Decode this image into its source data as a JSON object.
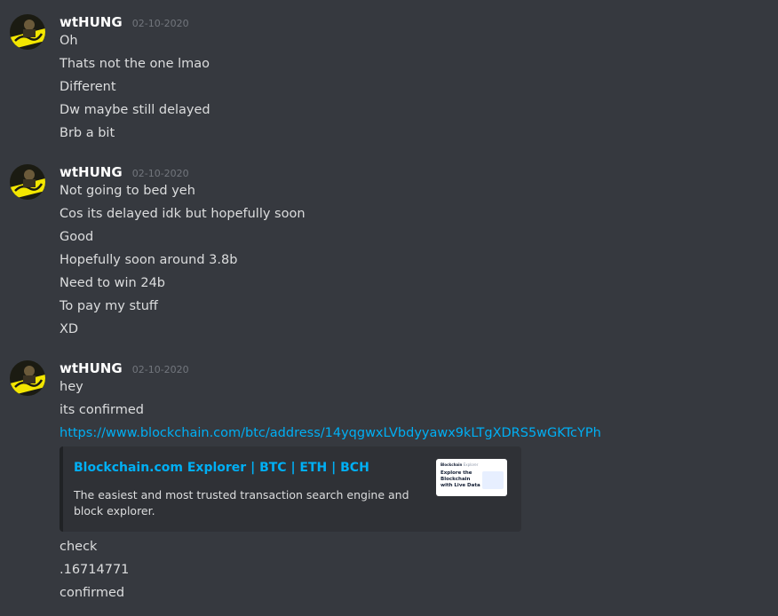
{
  "groups": [
    {
      "username": "wtHUNG",
      "timestamp": "02-10-2020",
      "messages": [
        "Oh",
        "Thats not the one lmao",
        "Different",
        "Dw maybe still delayed",
        "Brb a bit"
      ]
    },
    {
      "username": "wtHUNG",
      "timestamp": "02-10-2020",
      "messages": [
        "Not going to bed yeh",
        "Cos its delayed idk but hopefully soon",
        "Good",
        "Hopefully soon around 3.8b",
        "Need to win 24b",
        "To pay my stuff",
        "XD"
      ]
    },
    {
      "username": "wtHUNG",
      "timestamp": "02-10-2020",
      "messages": [
        "hey",
        "its confirmed"
      ],
      "link": "https://www.blockchain.com/btc/address/14yqgwxLVbdyyawx9kLTgXDRS5wGKTcYPh",
      "embed": {
        "title": "Blockchain.com Explorer | BTC | ETH | BCH",
        "description": "The easiest and most trusted transaction search engine and block explorer.",
        "thumbnail": {
          "brand": "Blockchain",
          "section": "Explorer",
          "headline": "Explore the Blockchain with Live Data"
        }
      },
      "after_messages": [
        "check",
        ".16714771",
        "confirmed"
      ]
    }
  ],
  "colors": {
    "background": "#36393f",
    "username": "#ffffff",
    "timestamp": "#72767d",
    "text": "#dcddde",
    "link": "#00aff4",
    "embed_bg": "#2f3136",
    "avatar_accent": "#f3e600"
  },
  "icons": {
    "avatar": "cyberpunk-avatar-icon"
  }
}
